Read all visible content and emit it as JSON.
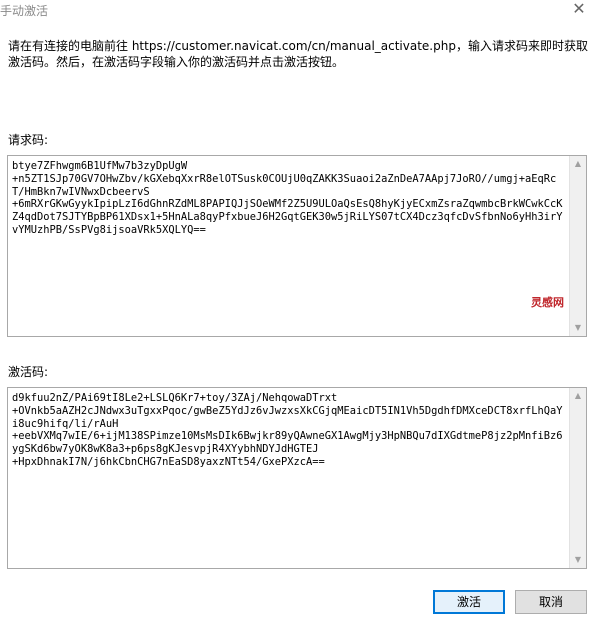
{
  "window": {
    "title": "手动激活",
    "close_glyph": "✕"
  },
  "instruction": "请在有连接的电脑前往 https://customer.navicat.com/cn/manual_activate.php，输入请求码来即时获取激活码。然后，在激活码字段输入你的激活码并点击激活按钮。",
  "request_code": {
    "label": "请求码:",
    "value": "btye7ZFhwgm6B1UfMw7b3zyDpUgW\n+n5ZT1SJp70GV7OHwZbv/kGXebqXxrR8elOTSusk0COUjU0qZAKK3Suaoi2aZnDeA7AApj7JoRO//umgj+aEqRcT/HmBkn7wIVNwxDcbeervS\n+6mRXrGKwGyykIpipLzI6dGhnRZdML8PAPIQJjSOeWMf2Z5U9ULOaQsEsQ8hyKjyECxmZsraZqwmbcBrkWCwkCcKZ4qdDot7SJTYBpBP61XDsx1+5HnALa8qyPfxbueJ6H2GqtGEK30w5jRiLYS07tCX4Dcz3qfcDvSfbnNo6yHh3irYvYMUzhPB/SsPVg8ijsoaVRk5XQLYQ=="
  },
  "watermark": "灵感网",
  "activation_code": {
    "label": "激活码:",
    "value": "d9kfuu2nZ/PAi69tI8Le2+LSLQ6Kr7+toy/3ZAj/NehqowaDTrxt\n+OVnkb5aAZH2cJNdwx3uTgxxPqoc/gwBeZ5YdJz6vJwzxsXkCGjqMEaicDT5IN1Vh5DgdhfDMXceDCT8xrfLhQaYi8uc9hifq/li/rAuH\n+eebVXMq7wIE/6+ijM138SPimze10MsMsDIk6Bwjkr89yQAwneGX1AwgMjy3HpNBQu7dIXGdtmeP8jz2pMnfiBz6ygSKd6bw7yOK8wK8a3+p6ps8gKJesvpjR4XYybhNDYJdHGTEJ\n+HpxDhnakI7N/j6hkCbnCHG7nEaSD8yaxzNTt54/GxePXzcA=="
  },
  "buttons": {
    "activate": "激活",
    "cancel": "取消"
  },
  "colors": {
    "title_text": "#8a8a8a",
    "border": "#a8a8a8",
    "primary_border": "#0078d7",
    "watermark": "#c0282d"
  }
}
